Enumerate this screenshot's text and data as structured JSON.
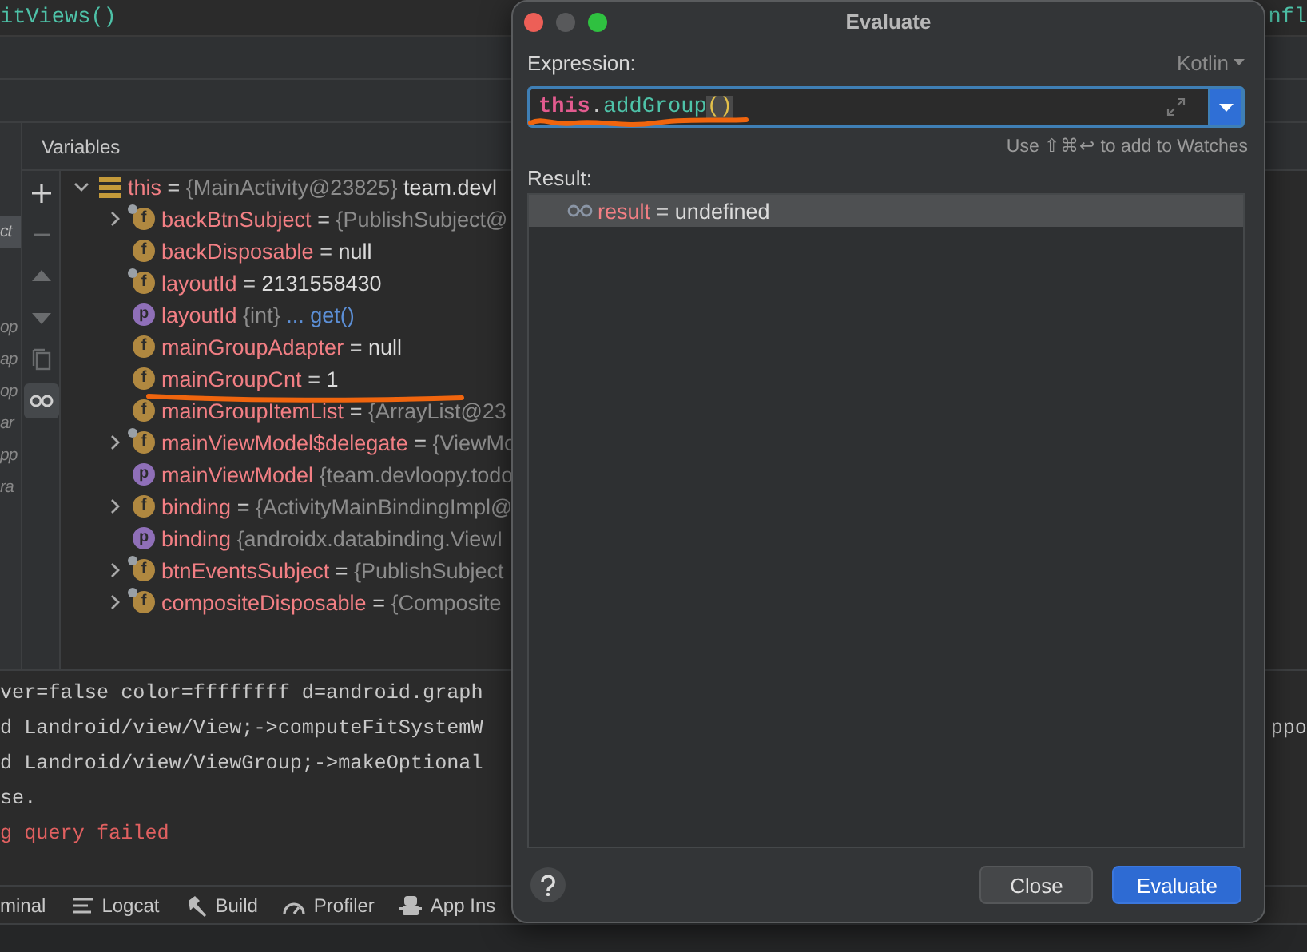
{
  "editor": {
    "code_left": "itViews()",
    "code_right": "nfl"
  },
  "debugger": {
    "title": "Variables",
    "frames": [
      {
        "text": "ct",
        "selected": true
      },
      {
        "text": "op",
        "selected": false
      },
      {
        "text": "ap",
        "selected": false
      },
      {
        "text": "op",
        "selected": false
      },
      {
        "text": "ar",
        "selected": false
      },
      {
        "text": "pp",
        "selected": false
      },
      {
        "text": "ra",
        "selected": false
      }
    ],
    "toolbar": [
      {
        "kind": "add",
        "selected": false,
        "disabled": false
      },
      {
        "kind": "remove",
        "selected": false,
        "disabled": true
      },
      {
        "kind": "up",
        "selected": false,
        "disabled": true
      },
      {
        "kind": "down",
        "selected": false,
        "disabled": true
      },
      {
        "kind": "copy",
        "selected": false,
        "disabled": true
      },
      {
        "kind": "watch",
        "selected": true,
        "disabled": false
      }
    ],
    "variables": [
      {
        "name": "this",
        "kind": "object",
        "expanded": true,
        "equals": "=",
        "value": "{MainActivity@23825}",
        "literal": "team.devl",
        "underlined": false,
        "children": [
          {
            "name": "backBtnSubject",
            "kind": "field",
            "icon_letter": "f",
            "final": true,
            "expanded": false,
            "equals": "=",
            "value": "{PublishSubject@",
            "underlined": false
          },
          {
            "name": "backDisposable",
            "kind": "field",
            "icon_letter": "f",
            "final": false,
            "equals": "=",
            "literal": "null",
            "underlined": false
          },
          {
            "name": "layoutId",
            "kind": "field",
            "icon_letter": "f",
            "final": true,
            "equals": "=",
            "literal": "2131558430",
            "underlined": false
          },
          {
            "name": "layoutId",
            "kind": "property",
            "icon_letter": "p",
            "final": false,
            "value": "{int}",
            "link": "... get()",
            "underlined": false
          },
          {
            "name": "mainGroupAdapter",
            "kind": "field",
            "icon_letter": "f",
            "final": false,
            "equals": "=",
            "literal": "null",
            "underlined": false
          },
          {
            "name": "mainGroupCnt",
            "kind": "field",
            "icon_letter": "f",
            "final": false,
            "equals": "=",
            "literal": "1",
            "underlined": true
          },
          {
            "name": "mainGroupItemList",
            "kind": "field",
            "icon_letter": "f",
            "final": false,
            "equals": "=",
            "value": "{ArrayList@23",
            "underlined": false
          },
          {
            "name": "mainViewModel$delegate",
            "kind": "field",
            "icon_letter": "f",
            "final": true,
            "expanded": false,
            "equals": "=",
            "value": "{ViewMo",
            "underlined": false
          },
          {
            "name": "mainViewModel",
            "kind": "property",
            "icon_letter": "p",
            "final": false,
            "value": "{team.devloopy.todo",
            "underlined": false
          },
          {
            "name": "binding",
            "kind": "field",
            "icon_letter": "f",
            "final": false,
            "expanded": false,
            "equals": "=",
            "value": "{ActivityMainBindingImpl@",
            "underlined": false
          },
          {
            "name": "binding",
            "kind": "property",
            "icon_letter": "p",
            "final": false,
            "value": "{androidx.databinding.ViewI",
            "underlined": false
          },
          {
            "name": "btnEventsSubject",
            "kind": "field",
            "icon_letter": "f",
            "final": true,
            "expanded": false,
            "equals": "=",
            "value": "{PublishSubject",
            "underlined": false
          },
          {
            "name": "compositeDisposable",
            "kind": "field",
            "icon_letter": "f",
            "final": true,
            "expanded": false,
            "equals": "=",
            "value": "{Composite",
            "underlined": false
          }
        ]
      }
    ]
  },
  "console": {
    "lines": [
      {
        "text": "ver=false color=ffffffff d=android.graph",
        "kind": "info"
      },
      {
        "text": "d Landroid/view/View;->computeFitSystemW",
        "kind": "info",
        "right": "ppo"
      },
      {
        "text": "d Landroid/view/ViewGroup;->makeOptional",
        "kind": "info"
      },
      {
        "text": "se.",
        "kind": "info"
      },
      {
        "text": "g query failed",
        "kind": "error"
      }
    ]
  },
  "tool_tabs": [
    {
      "label": "minal",
      "kind": "plain"
    },
    {
      "label": "Logcat",
      "kind": "lines"
    },
    {
      "label": "Build",
      "kind": "hammer"
    },
    {
      "label": "Profiler",
      "kind": "gauge"
    },
    {
      "label": "App Ins",
      "kind": "inspector"
    }
  ],
  "dialog": {
    "title": "Evaluate",
    "expression_label": "Expression:",
    "language": "Kotlin",
    "expression": {
      "underlined": true,
      "tokens": [
        {
          "text": "this",
          "kind": "keyword"
        },
        {
          "text": ".",
          "kind": "plain"
        },
        {
          "text": "addGroup",
          "kind": "function"
        },
        {
          "text": "()",
          "kind": "paren"
        }
      ]
    },
    "hint": "Use ⇧⌘↩ to add to Watches",
    "result_label": "Result:",
    "results": [
      {
        "name": "result",
        "equals": "=",
        "value": "undefined",
        "selected": true
      }
    ],
    "buttons": [
      {
        "label": "Close",
        "kind": "default"
      },
      {
        "label": "Evaluate",
        "kind": "primary"
      }
    ]
  }
}
